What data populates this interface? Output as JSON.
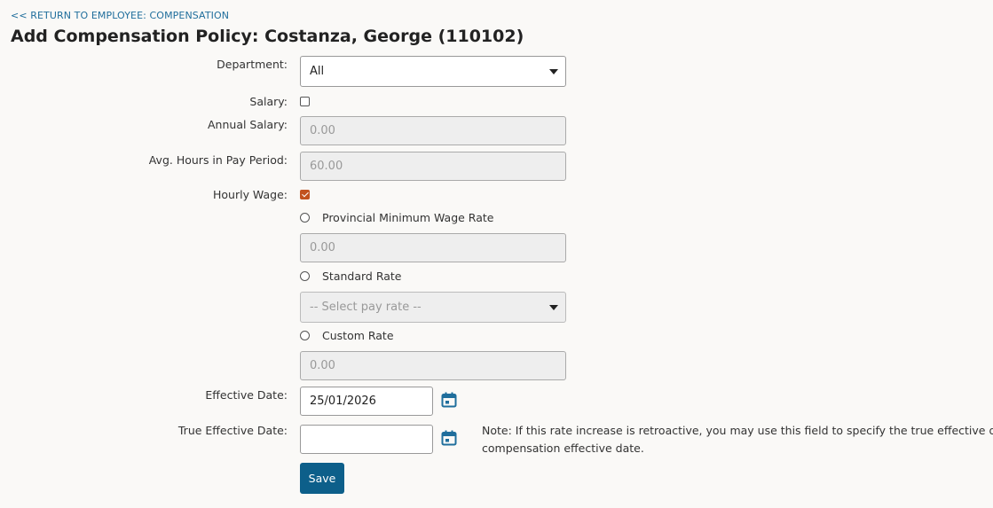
{
  "header": {
    "back_link": "<< RETURN TO EMPLOYEE: COMPENSATION",
    "title": "Add Compensation Policy: Costanza, George (110102)"
  },
  "form": {
    "department": {
      "label": "Department:",
      "value": "All"
    },
    "salary": {
      "label": "Salary:",
      "checked": false
    },
    "annual_salary": {
      "label": "Annual Salary:",
      "value": "0.00"
    },
    "avg_hours": {
      "label": "Avg. Hours in Pay Period:",
      "value": "60.00"
    },
    "hourly_wage": {
      "label": "Hourly Wage:",
      "checked": true
    },
    "provincial_min_wage": {
      "label": "Provincial Minimum Wage Rate",
      "value": "0.00"
    },
    "standard_rate": {
      "label": "Standard Rate",
      "placeholder": "-- Select pay rate --"
    },
    "custom_rate": {
      "label": "Custom Rate",
      "value": "0.00"
    },
    "effective_date": {
      "label": "Effective Date:",
      "value": "25/01/2026"
    },
    "true_effective_date": {
      "label": "True Effective Date:",
      "value": "",
      "note": "Note: If this rate increase is retroactive, you may use this field to specify the true effective date compensation effective date."
    },
    "save_label": "Save"
  },
  "colors": {
    "link": "#1f6e9c",
    "checkbox_checked": "#c2521f",
    "primary_button": "#0d5f8a",
    "calendar_icon": "#1f6e9c"
  }
}
